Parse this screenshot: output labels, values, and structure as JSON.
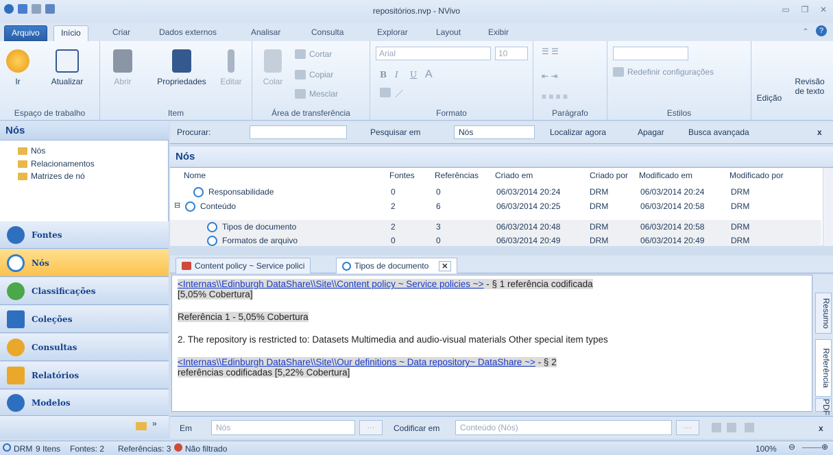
{
  "window": {
    "title": "repositórios.nvp - NVivo"
  },
  "tabs": [
    "Arquivo",
    "Início",
    "Criar",
    "Dados externos",
    "Analisar",
    "Consulta",
    "Explorar",
    "Layout",
    "Exibir"
  ],
  "ribbon": {
    "workspace": {
      "ir": "Ir",
      "atualizar": "Atualizar",
      "label": "Espaço de trabalho"
    },
    "item": {
      "abrir": "Abrir",
      "propriedades": "Propriedades",
      "editar": "Editar",
      "label": "Item"
    },
    "clipboard": {
      "colar": "Colar",
      "cortar": "Cortar",
      "copiar": "Copiar",
      "mesclar": "Mesclar",
      "label": "Área de transferência"
    },
    "formato": {
      "font": "Arial",
      "size": "10",
      "bold": "B",
      "italic": "I",
      "underline": "U",
      "label": "Formato"
    },
    "paragrafo": {
      "label": "Parágrafo"
    },
    "estilos": {
      "redefinir": "Redefinir configurações",
      "label": "Estilos"
    },
    "edicao": "Edição",
    "revisao": "Revisão",
    "revisao2": "de texto"
  },
  "nav": {
    "header": "Nós",
    "tree": [
      "Nós",
      "Relacionamentos",
      "Matrizes de nó"
    ],
    "buttons": [
      "Fontes",
      "Nós",
      "Classificações",
      "Coleções",
      "Consultas",
      "Relatórios",
      "Modelos"
    ]
  },
  "search": {
    "procurar": "Procurar:",
    "pesquisar_em": "Pesquisar em",
    "scope": "Nós",
    "localizar": "Localizar agora",
    "apagar": "Apagar",
    "avancada": "Busca avançada",
    "close": "x"
  },
  "nodes": {
    "title": "Nós",
    "columns": [
      "Nome",
      "Fontes",
      "Referências",
      "Criado em",
      "Criado por",
      "Modificado em",
      "Modificado por"
    ],
    "rows": [
      {
        "nome": "Responsabilidade",
        "fontes": "0",
        "refs": "0",
        "criado": "06/03/2014 20:24",
        "por": "DRM",
        "mod": "06/03/2014 20:24",
        "modpor": "DRM"
      },
      {
        "nome": "Conteúdo",
        "fontes": "2",
        "refs": "6",
        "criado": "06/03/2014 20:25",
        "por": "DRM",
        "mod": "06/03/2014 20:58",
        "modpor": "DRM"
      },
      {
        "nome": "Tipos de documento",
        "fontes": "2",
        "refs": "3",
        "criado": "06/03/2014 20:48",
        "por": "DRM",
        "mod": "06/03/2014 20:58",
        "modpor": "DRM"
      },
      {
        "nome": "Formatos de arquivo",
        "fontes": "0",
        "refs": "0",
        "criado": "06/03/2014 20:49",
        "por": "DRM",
        "mod": "06/03/2014 20:49",
        "modpor": "DRM"
      }
    ]
  },
  "doctabs": [
    "Content policy ~ Service polici",
    "Tipos de documento"
  ],
  "doc": {
    "link1": "<Internas\\\\Edinburgh DataShare\\\\Site\\\\Content policy ~ Service policies ~>",
    "link1_tail": " - § 1 referência codificada",
    "cov1": "[5,05% Cobertura]",
    "ref1": "Referência 1 - 5,05% Cobertura",
    "para1": "2. The repository is restricted to: Datasets Multimedia and audio-visual materials Other special item types",
    "link2": "<Internas\\\\Edinburgh DataShare\\\\Site\\\\Our definitions ~ Data repository~ DataShare ~>",
    "link2_tail": " - § 2",
    "cov2": "referências codificadas  [5,22% Cobertura]"
  },
  "sidetabs": [
    "Resumo",
    "Referência",
    "PDF"
  ],
  "codebar": {
    "em": "Em",
    "em_value": "Nós",
    "codificar": "Codificar em",
    "cod_value": "Conteúdo (Nós)",
    "close": "x"
  },
  "status": {
    "user": "DRM",
    "items": "9 Itens",
    "fontes": "Fontes: 2",
    "refs": "Referências: 3",
    "filtro": "Não filtrado",
    "zoom": "100%"
  }
}
